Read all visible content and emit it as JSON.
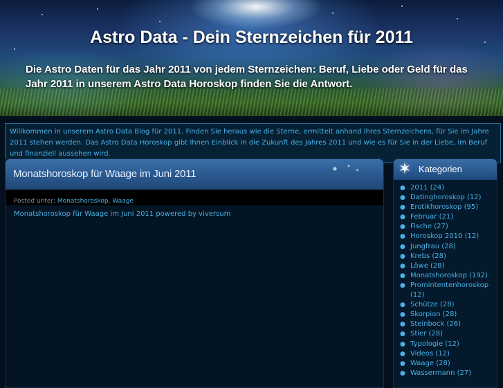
{
  "header": {
    "title": "Astro Data - Dein Sternzeichen für 2011",
    "description": "Die Astro Daten für das Jahr 2011 von jedem Sternzeichen: Beruf, Liebe oder Geld für das Jahr 2011 in unserem Astro Data Horoskop finden Sie die Antwort."
  },
  "intro": {
    "text": "Willkommen in unserem Astro Data Blog für 2011. Finden Sie heraus wie die Sterne, ermittelt anhand ihres Sternzeichens, für Sie im Jahre 2011 stehen werden. Das Astro Data Horoskop gibt Ihnen Einblick in die Zukunft des Jahres 2011 und wie es für Sie in der Liebe, im Beruf und finanziell aussehen wird."
  },
  "post": {
    "title": "Monatshoroskop für Waage im Juni 2011",
    "posted_label": "Posted unter:",
    "categories": [
      "Monatshoroskop",
      "Waage"
    ],
    "separator": ",",
    "body": "Monatshoroskop für Waage im Juni 2011 powered by viversum"
  },
  "sidebar": {
    "title": "Kategorien",
    "items": [
      {
        "label": "2011",
        "count": "(24)"
      },
      {
        "label": "Datinghoroskop",
        "count": "(12)"
      },
      {
        "label": "Erotikhoroskop",
        "count": "(95)"
      },
      {
        "label": "Februar",
        "count": "(21)"
      },
      {
        "label": "Fische",
        "count": "(27)"
      },
      {
        "label": "Horoskop 2010",
        "count": "(12)"
      },
      {
        "label": "Jungfrau",
        "count": "(28)"
      },
      {
        "label": "Krebs",
        "count": "(28)"
      },
      {
        "label": "Löwe",
        "count": "(28)"
      },
      {
        "label": "Monatshoroskop",
        "count": "(192)"
      },
      {
        "label": "Promintentenhoroskop",
        "count": "(12)"
      },
      {
        "label": "Schütze",
        "count": "(28)"
      },
      {
        "label": "Skorpion",
        "count": "(28)"
      },
      {
        "label": "Steinbock",
        "count": "(26)"
      },
      {
        "label": "Stier",
        "count": "(28)"
      },
      {
        "label": "Typologie",
        "count": "(12)"
      },
      {
        "label": "Videos",
        "count": "(12)"
      },
      {
        "label": "Waage",
        "count": "(28)"
      },
      {
        "label": "Wassermann",
        "count": "(27)"
      }
    ]
  },
  "colors": {
    "link": "#4ab0e4",
    "header_bar": "#2b5a90",
    "background": "#03101d"
  },
  "icons": {
    "bullet": "bullet-icon",
    "sidebar_star": "star-icon"
  }
}
